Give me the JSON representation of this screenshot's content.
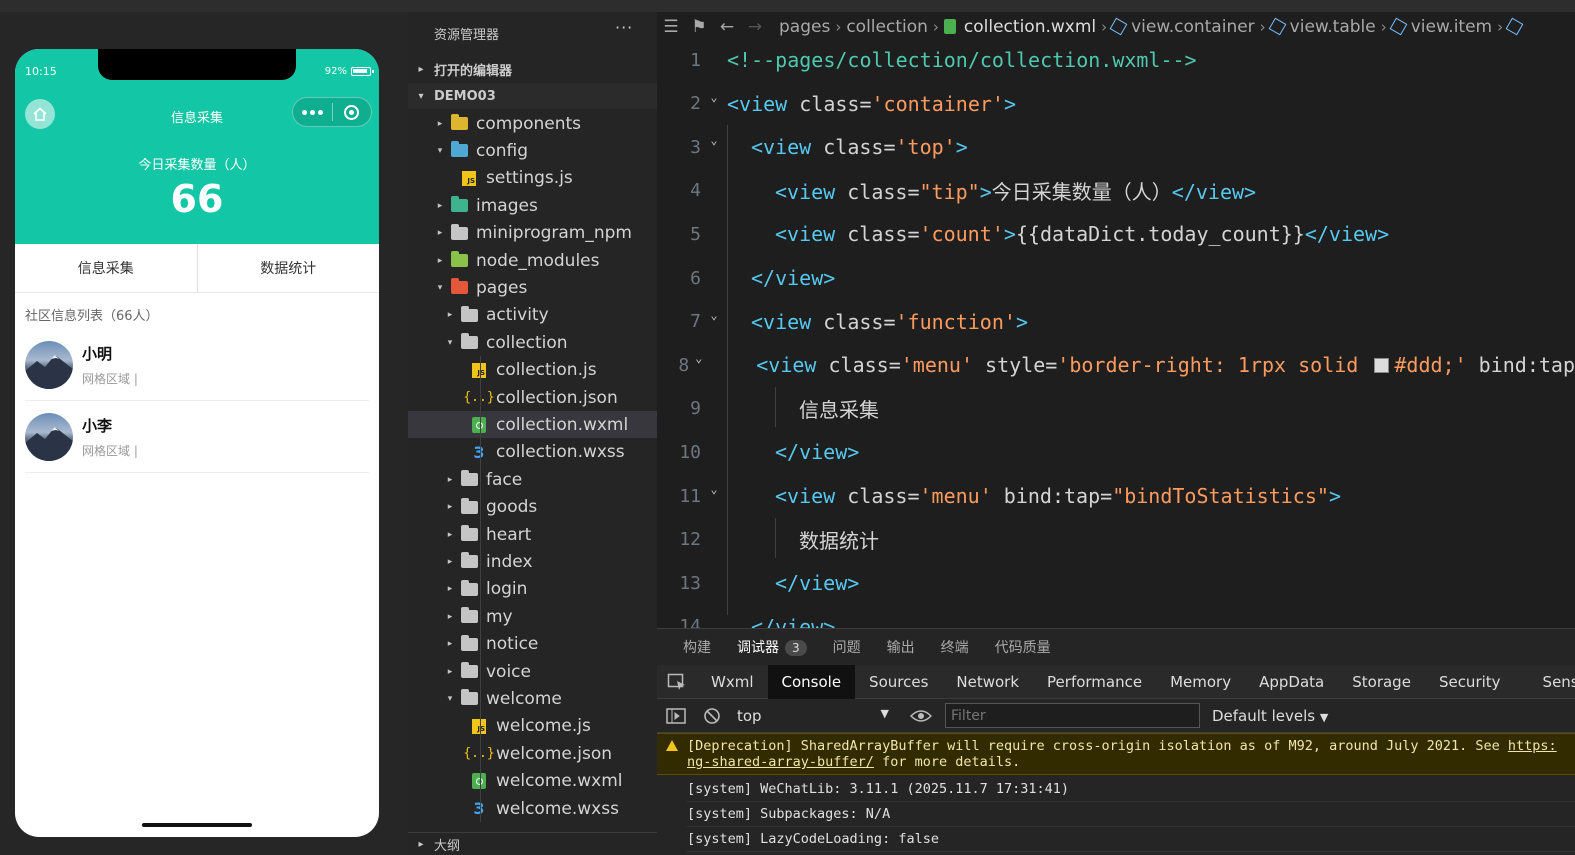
{
  "phone": {
    "status_time": "10:15",
    "battery": "92%",
    "nav_title": "信息采集",
    "tip": "今日采集数量（人）",
    "count": "66",
    "menus": [
      "信息采集",
      "数据统计"
    ],
    "list_title": "社区信息列表（66人）",
    "people": [
      {
        "name": "小明",
        "area": "网格区域 |"
      },
      {
        "name": "小李",
        "area": "网格区域 |"
      }
    ]
  },
  "explorer": {
    "title": "资源管理器",
    "more": "···",
    "open_editors": "打开的编辑器",
    "project": "DEMO03",
    "outline": "大纲",
    "items": [
      {
        "label": "components",
        "depth": 0,
        "arrow": "▸",
        "icon": "folder-yellow"
      },
      {
        "label": "config",
        "depth": 0,
        "arrow": "▾",
        "icon": "folder-blue"
      },
      {
        "label": "settings.js",
        "depth": 1,
        "arrow": "",
        "icon": "js"
      },
      {
        "label": "images",
        "depth": 0,
        "arrow": "▸",
        "icon": "folder-teal"
      },
      {
        "label": "miniprogram_npm",
        "depth": 0,
        "arrow": "▸",
        "icon": "folder"
      },
      {
        "label": "node_modules",
        "depth": 0,
        "arrow": "▸",
        "icon": "folder-green"
      },
      {
        "label": "pages",
        "depth": 0,
        "arrow": "▾",
        "icon": "folder-red"
      },
      {
        "label": "activity",
        "depth": 1,
        "arrow": "▸",
        "icon": "folder"
      },
      {
        "label": "collection",
        "depth": 1,
        "arrow": "▾",
        "icon": "folder"
      },
      {
        "label": "collection.js",
        "depth": 2,
        "arrow": "",
        "icon": "js"
      },
      {
        "label": "collection.json",
        "depth": 2,
        "arrow": "",
        "icon": "json"
      },
      {
        "label": "collection.wxml",
        "depth": 2,
        "arrow": "",
        "icon": "wxml",
        "selected": true
      },
      {
        "label": "collection.wxss",
        "depth": 2,
        "arrow": "",
        "icon": "wxss"
      },
      {
        "label": "face",
        "depth": 1,
        "arrow": "▸",
        "icon": "folder"
      },
      {
        "label": "goods",
        "depth": 1,
        "arrow": "▸",
        "icon": "folder"
      },
      {
        "label": "heart",
        "depth": 1,
        "arrow": "▸",
        "icon": "folder"
      },
      {
        "label": "index",
        "depth": 1,
        "arrow": "▸",
        "icon": "folder"
      },
      {
        "label": "login",
        "depth": 1,
        "arrow": "▸",
        "icon": "folder"
      },
      {
        "label": "my",
        "depth": 1,
        "arrow": "▸",
        "icon": "folder"
      },
      {
        "label": "notice",
        "depth": 1,
        "arrow": "▸",
        "icon": "folder"
      },
      {
        "label": "voice",
        "depth": 1,
        "arrow": "▸",
        "icon": "folder"
      },
      {
        "label": "welcome",
        "depth": 1,
        "arrow": "▾",
        "icon": "folder"
      },
      {
        "label": "welcome.js",
        "depth": 2,
        "arrow": "",
        "icon": "js"
      },
      {
        "label": "welcome.json",
        "depth": 2,
        "arrow": "",
        "icon": "json"
      },
      {
        "label": "welcome.wxml",
        "depth": 2,
        "arrow": "",
        "icon": "wxml"
      },
      {
        "label": "welcome.wxss",
        "depth": 2,
        "arrow": "",
        "icon": "wxss"
      }
    ]
  },
  "breadcrumb": {
    "parts": [
      "pages",
      "collection",
      "collection.wxml",
      "view.container",
      "view.table",
      "view.item"
    ]
  },
  "code": {
    "lines": [
      {
        "n": "1",
        "fold": false,
        "indent": 0,
        "tokens": [
          [
            "cmt",
            "<!--pages/collection/collection.wxml-->"
          ]
        ]
      },
      {
        "n": "2",
        "fold": true,
        "indent": 0,
        "tokens": [
          [
            "tag",
            "<view"
          ],
          [
            "attr",
            " class="
          ],
          [
            "str",
            "'container'"
          ],
          [
            "tag",
            ">"
          ]
        ]
      },
      {
        "n": "3",
        "fold": true,
        "indent": 1,
        "tokens": [
          [
            "tag",
            "<view"
          ],
          [
            "attr",
            " class="
          ],
          [
            "str",
            "'top'"
          ],
          [
            "tag",
            ">"
          ]
        ]
      },
      {
        "n": "4",
        "fold": false,
        "indent": 2,
        "tokens": [
          [
            "tag",
            "<view"
          ],
          [
            "attr",
            " class="
          ],
          [
            "str",
            "\"tip\""
          ],
          [
            "tag",
            ">"
          ],
          [
            "txt",
            "今日采集数量（人）"
          ],
          [
            "tag",
            "</view>"
          ]
        ]
      },
      {
        "n": "5",
        "fold": false,
        "indent": 2,
        "tokens": [
          [
            "tag",
            "<view"
          ],
          [
            "attr",
            " class="
          ],
          [
            "str",
            "'count'"
          ],
          [
            "tag",
            ">"
          ],
          [
            "txt",
            "{{dataDict.today_count}}"
          ],
          [
            "tag",
            "</view>"
          ]
        ]
      },
      {
        "n": "6",
        "fold": false,
        "indent": 1,
        "tokens": [
          [
            "tag",
            "</view>"
          ]
        ]
      },
      {
        "n": "7",
        "fold": true,
        "indent": 1,
        "tokens": [
          [
            "tag",
            "<view"
          ],
          [
            "attr",
            " class="
          ],
          [
            "str",
            "'function'"
          ],
          [
            "tag",
            ">"
          ]
        ]
      },
      {
        "n": "8",
        "fold": true,
        "indent": 2,
        "tokens": [
          [
            "tag",
            "<view"
          ],
          [
            "attr",
            " class="
          ],
          [
            "str",
            "'menu'"
          ],
          [
            "attr",
            " style="
          ],
          [
            "str",
            "'border-right: 1rpx solid "
          ],
          [
            "swatch",
            ""
          ],
          [
            "str",
            "#ddd;'"
          ],
          [
            "attr",
            " bind:tap"
          ]
        ]
      },
      {
        "n": "9",
        "fold": false,
        "indent": 3,
        "tokens": [
          [
            "txt",
            "信息采集"
          ]
        ]
      },
      {
        "n": "10",
        "fold": false,
        "indent": 2,
        "tokens": [
          [
            "tag",
            "</view>"
          ]
        ]
      },
      {
        "n": "11",
        "fold": true,
        "indent": 2,
        "tokens": [
          [
            "tag",
            "<view"
          ],
          [
            "attr",
            " class="
          ],
          [
            "str",
            "'menu'"
          ],
          [
            "attr",
            " bind:tap="
          ],
          [
            "str",
            "\"bindToStatistics\""
          ],
          [
            "tag",
            ">"
          ]
        ]
      },
      {
        "n": "12",
        "fold": false,
        "indent": 3,
        "tokens": [
          [
            "txt",
            "数据统计"
          ]
        ]
      },
      {
        "n": "13",
        "fold": false,
        "indent": 2,
        "tokens": [
          [
            "tag",
            "</view>"
          ]
        ]
      },
      {
        "n": "14",
        "fold": false,
        "indent": 1,
        "tokens": [
          [
            "tag",
            "</view>"
          ]
        ]
      }
    ]
  },
  "panel": {
    "tabs": [
      "构建",
      "调试器",
      "问题",
      "输出",
      "终端",
      "代码质量"
    ],
    "debugger_badge": "3",
    "devtools_tabs": [
      "Wxml",
      "Console",
      "Sources",
      "Network",
      "Performance",
      "Memory",
      "AppData",
      "Storage",
      "Security",
      "Sensor"
    ],
    "context": "top",
    "filter_placeholder": "Filter",
    "levels": "Default levels",
    "warn_line1": "[Deprecation] SharedArrayBuffer will require cross-origin isolation as of M92, around July 2021. See ",
    "warn_link1": "https:",
    "warn_link2": "ng-shared-array-buffer/",
    "warn_line2_rest": " for more details.",
    "logs": [
      "[system] WeChatLib: 3.11.1 (2025.11.7 17:31:41)",
      "[system] Subpackages: N/A",
      "[system] LazyCodeLoading: false"
    ]
  }
}
